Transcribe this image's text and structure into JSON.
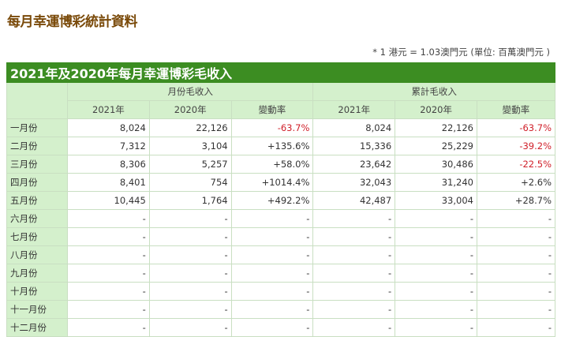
{
  "title": "每月幸運博彩統計資料",
  "note": "* 1 港元 = 1.03澳門元 (單位: 百萬澳門元 )",
  "table": {
    "caption": "2021年及2020年每月幸運博彩毛收入",
    "group_monthly": "月份毛收入",
    "group_cumulative": "累計毛收入",
    "col_2021": "2021年",
    "col_2020": "2020年",
    "col_change": "變動率",
    "rows": [
      [
        "一月份",
        "8,024",
        "22,126",
        "-63.7%",
        "8,024",
        "22,126",
        "-63.7%"
      ],
      [
        "二月份",
        "7,312",
        "3,104",
        "+135.6%",
        "15,336",
        "25,229",
        "-39.2%"
      ],
      [
        "三月份",
        "8,306",
        "5,257",
        "+58.0%",
        "23,642",
        "30,486",
        "-22.5%"
      ],
      [
        "四月份",
        "8,401",
        "754",
        "+1014.4%",
        "32,043",
        "31,240",
        "+2.6%"
      ],
      [
        "五月份",
        "10,445",
        "1,764",
        "+492.2%",
        "42,487",
        "33,004",
        "+28.7%"
      ],
      [
        "六月份",
        "-",
        "-",
        "-",
        "-",
        "-",
        "-"
      ],
      [
        "七月份",
        "-",
        "-",
        "-",
        "-",
        "-",
        "-"
      ],
      [
        "八月份",
        "-",
        "-",
        "-",
        "-",
        "-",
        "-"
      ],
      [
        "九月份",
        "-",
        "-",
        "-",
        "-",
        "-",
        "-"
      ],
      [
        "十月份",
        "-",
        "-",
        "-",
        "-",
        "-",
        "-"
      ],
      [
        "十一月份",
        "-",
        "-",
        "-",
        "-",
        "-",
        "-"
      ],
      [
        "十二月份",
        "-",
        "-",
        "-",
        "-",
        "-",
        "-"
      ]
    ]
  }
}
